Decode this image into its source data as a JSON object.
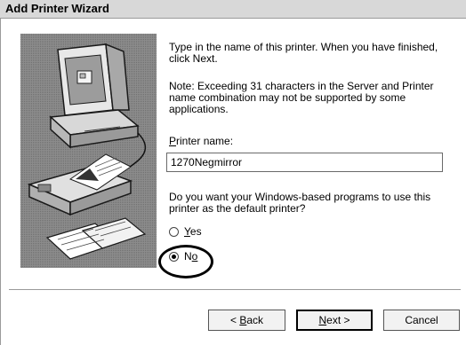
{
  "window": {
    "title": "Add Printer Wizard"
  },
  "illustration": {
    "name": "computer-fax-printer-illustration"
  },
  "content": {
    "intro": "Type in the name of this printer.  When you have finished, click Next.",
    "note": "Note:  Exceeding 31 characters in the Server and Printer name combination may not be supported by some applications.",
    "printer_name_label_mnemonic": "P",
    "printer_name_label_rest": "rinter name:",
    "printer_name_value": "1270Negmirror",
    "default_question": "Do you want your Windows-based programs to use this printer as the default printer?",
    "options": [
      {
        "pre": "",
        "mnemonic": "Y",
        "post": "es",
        "checked": false
      },
      {
        "pre": "N",
        "mnemonic": "o",
        "post": "",
        "checked": true
      }
    ]
  },
  "buttons": {
    "back": {
      "pre": "< ",
      "mnemonic": "B",
      "post": "ack"
    },
    "next": {
      "pre": "",
      "mnemonic": "N",
      "post": "ext >"
    },
    "cancel": {
      "label": "Cancel"
    }
  }
}
